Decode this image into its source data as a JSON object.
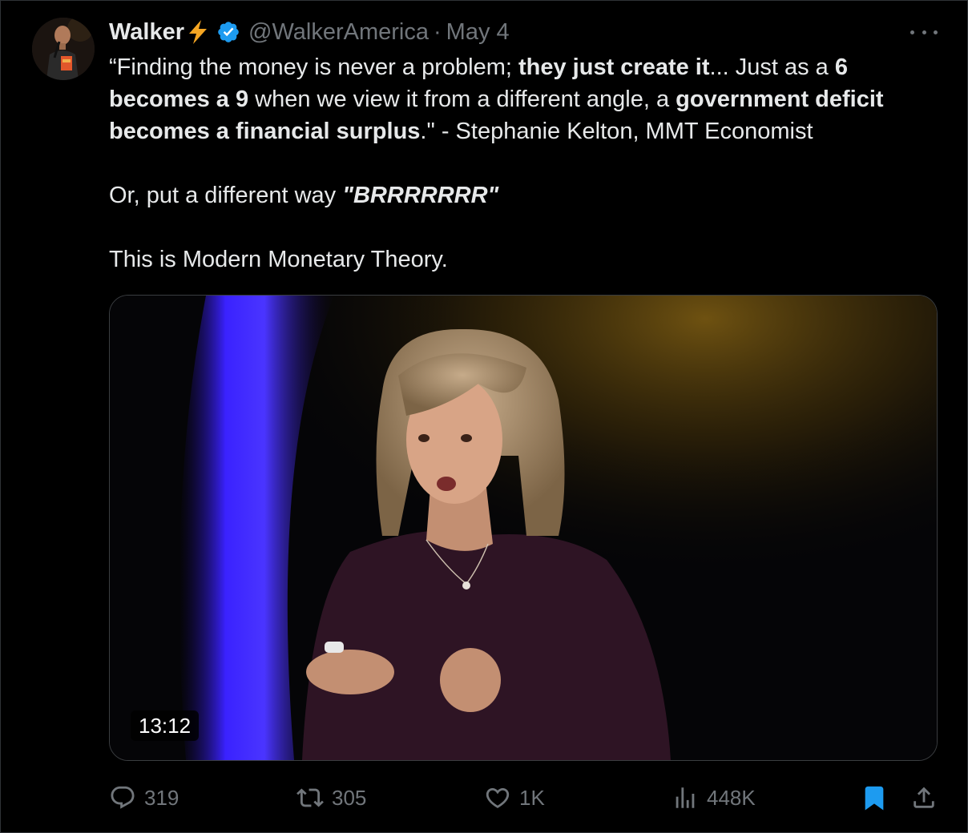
{
  "author": {
    "name": "Walker",
    "name_emoji_icon": "lightning-bolt-icon",
    "verified_icon": "verified-badge-icon",
    "handle": "@WalkerAmerica",
    "separator": "·",
    "date": "May 4",
    "avatar_icon": "avatar-image"
  },
  "tweet": {
    "p1_seg1": "“Finding the money is never a problem; ",
    "p1_seg2": "they just create it",
    "p1_seg3": "... Just as a ",
    "p1_seg4": "6 becomes a 9",
    "p1_seg5": " when we view it from a different angle, a ",
    "p1_seg6": "government deficit becomes a financial surplus",
    "p1_seg7": ".\" - Stephanie Kelton, MMT Economist",
    "p2_seg1": "Or, put a different way ",
    "p2_seg2": "\"BRRRRRRR\"",
    "p3": "This is Modern Monetary Theory."
  },
  "media": {
    "duration": "13:12"
  },
  "actions": {
    "replies": "319",
    "reposts": "305",
    "likes": "1K",
    "views": "448K"
  },
  "colors": {
    "background": "#000000",
    "text": "#e7e9ea",
    "muted": "#71767b",
    "verified": "#1d9bf0",
    "bookmark_active": "#1d9bf0",
    "bolt": "#f5a623"
  }
}
